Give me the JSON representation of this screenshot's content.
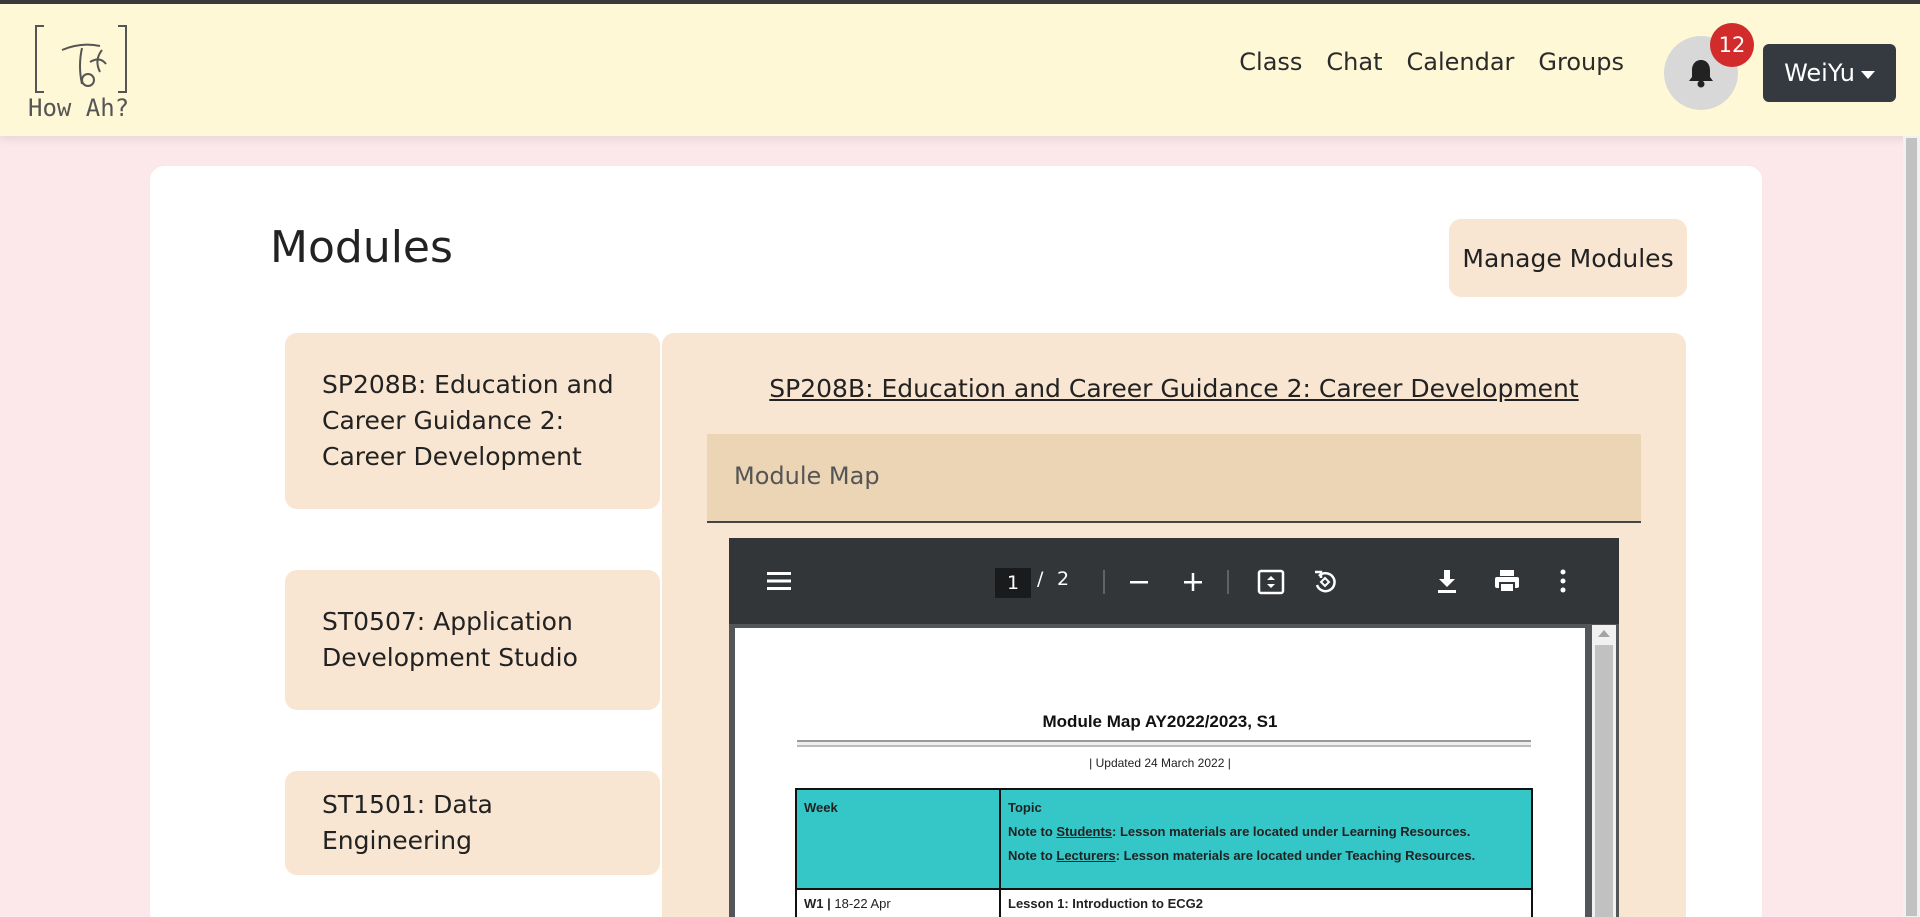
{
  "app": {
    "logo_text": "How Ah?",
    "nav": [
      "Class",
      "Chat",
      "Calendar",
      "Groups"
    ],
    "notification_count": "12",
    "user_name": "WeiYu"
  },
  "page": {
    "title": "Modules",
    "manage_button": "Manage Modules"
  },
  "modules": [
    {
      "label": "SP208B: Education and Career Guidance 2: Career Development"
    },
    {
      "label": "ST0507: Application Development Studio"
    },
    {
      "label": "ST1501: Data Engineering"
    }
  ],
  "detail": {
    "title": "SP208B: Education and Career Guidance 2: Career Development",
    "section_label": "Module Map"
  },
  "pdf_viewer": {
    "current_page": "1",
    "separator": "/",
    "total_pages": "2",
    "icons": [
      "menu-icon",
      "zoom-out-icon",
      "zoom-in-icon",
      "fit-page-icon",
      "rotate-icon",
      "download-icon",
      "print-icon",
      "more-icon"
    ]
  },
  "document": {
    "title": "Module Map AY2022/2023, S1",
    "updated": "| Updated 24 March 2022 |",
    "header_week": "Week",
    "header_topic": "Topic",
    "note1_prefix": "Note to ",
    "note1_who": "Students",
    "note1_rest": ": Lesson materials are located under Learning Resources.",
    "note2_prefix": "Note to ",
    "note2_who": "Lecturers",
    "note2_rest": ": Lesson materials are located under Teaching Resources.",
    "row1_week": "W1 |",
    "row1_dates": " 18-22 Apr",
    "row1_topic": "Lesson 1: Introduction to ECG2"
  },
  "colors": {
    "navbar_bg": "#fff8d6",
    "page_bg": "#fce8ea",
    "card_item_bg": "#f9e6d2",
    "badge": "#d12b2b",
    "table_header": "#35c7c7"
  }
}
